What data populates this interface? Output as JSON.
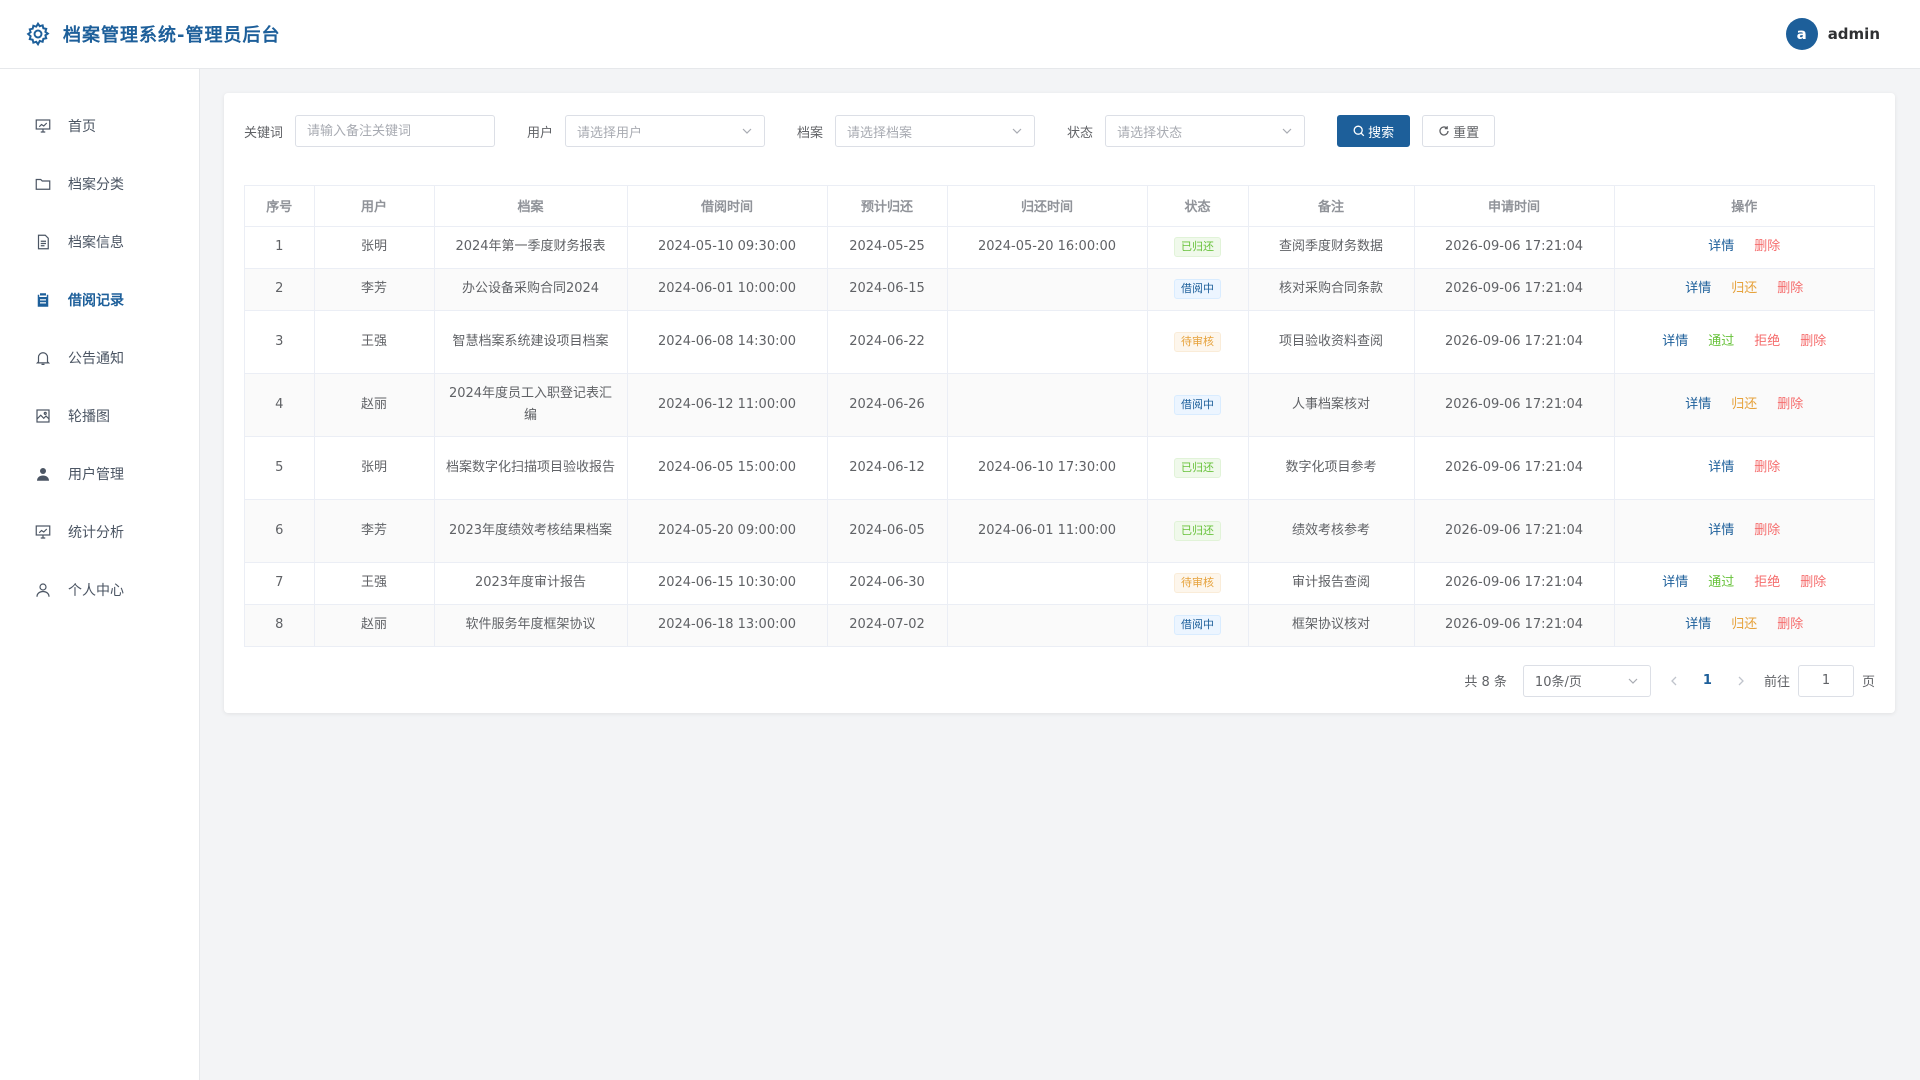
{
  "header": {
    "title": "档案管理系统-管理员后台",
    "avatar_letter": "a",
    "username": "admin"
  },
  "sidebar": {
    "items": [
      {
        "label": "首页",
        "icon": "monitor-icon"
      },
      {
        "label": "档案分类",
        "icon": "folder-icon"
      },
      {
        "label": "档案信息",
        "icon": "document-icon"
      },
      {
        "label": "借阅记录",
        "icon": "clipboard-icon",
        "active": true
      },
      {
        "label": "公告通知",
        "icon": "bell-icon"
      },
      {
        "label": "轮播图",
        "icon": "picture-icon"
      },
      {
        "label": "用户管理",
        "icon": "user-filled-icon"
      },
      {
        "label": "统计分析",
        "icon": "monitor-icon"
      },
      {
        "label": "个人中心",
        "icon": "user-icon"
      }
    ]
  },
  "filters": {
    "keyword_label": "关键词",
    "keyword_placeholder": "请输入备注关键词",
    "user_label": "用户",
    "user_placeholder": "请选择用户",
    "archive_label": "档案",
    "archive_placeholder": "请选择档案",
    "status_label": "状态",
    "status_placeholder": "请选择状态",
    "search_label": "搜索",
    "reset_label": "重置"
  },
  "table": {
    "columns": [
      "序号",
      "用户",
      "档案",
      "借阅时间",
      "预计归还",
      "归还时间",
      "状态",
      "备注",
      "申请时间",
      "操作"
    ],
    "rows": [
      {
        "no": "1",
        "user": "张明",
        "archive": "2024年第一季度财务报表",
        "borrow": "2024-05-10 09:30:00",
        "due": "2024-05-25",
        "returned": "2024-05-20 16:00:00",
        "status": "已归还",
        "status_type": "returned",
        "note": "查阅季度财务数据",
        "apply": "2026-09-06 17:21:04",
        "ops": [
          {
            "label": "详情",
            "type": "detail"
          },
          {
            "label": "删除",
            "type": "delete"
          }
        ]
      },
      {
        "no": "2",
        "user": "李芳",
        "archive": "办公设备采购合同2024",
        "borrow": "2024-06-01 10:00:00",
        "due": "2024-06-15",
        "returned": "",
        "status": "借阅中",
        "status_type": "borrowing",
        "note": "核对采购合同条款",
        "apply": "2026-09-06 17:21:04",
        "ops": [
          {
            "label": "详情",
            "type": "detail"
          },
          {
            "label": "归还",
            "type": "return"
          },
          {
            "label": "删除",
            "type": "delete"
          }
        ]
      },
      {
        "no": "3",
        "user": "王强",
        "archive": "智慧档案系统建设项目档案",
        "borrow": "2024-06-08 14:30:00",
        "due": "2024-06-22",
        "returned": "",
        "status": "待审核",
        "status_type": "pending",
        "note": "项目验收资料查阅",
        "apply": "2026-09-06 17:21:04",
        "ops": [
          {
            "label": "详情",
            "type": "detail"
          },
          {
            "label": "通过",
            "type": "approve"
          },
          {
            "label": "拒绝",
            "type": "reject"
          },
          {
            "label": "删除",
            "type": "delete"
          }
        ]
      },
      {
        "no": "4",
        "user": "赵丽",
        "archive": "2024年度员工入职登记表汇编",
        "borrow": "2024-06-12 11:00:00",
        "due": "2024-06-26",
        "returned": "",
        "status": "借阅中",
        "status_type": "borrowing",
        "note": "人事档案核对",
        "apply": "2026-09-06 17:21:04",
        "ops": [
          {
            "label": "详情",
            "type": "detail"
          },
          {
            "label": "归还",
            "type": "return"
          },
          {
            "label": "删除",
            "type": "delete"
          }
        ]
      },
      {
        "no": "5",
        "user": "张明",
        "archive": "档案数字化扫描项目验收报告",
        "borrow": "2024-06-05 15:00:00",
        "due": "2024-06-12",
        "returned": "2024-06-10 17:30:00",
        "status": "已归还",
        "status_type": "returned",
        "note": "数字化项目参考",
        "apply": "2026-09-06 17:21:04",
        "ops": [
          {
            "label": "详情",
            "type": "detail"
          },
          {
            "label": "删除",
            "type": "delete"
          }
        ]
      },
      {
        "no": "6",
        "user": "李芳",
        "archive": "2023年度绩效考核结果档案",
        "borrow": "2024-05-20 09:00:00",
        "due": "2024-06-05",
        "returned": "2024-06-01 11:00:00",
        "status": "已归还",
        "status_type": "returned",
        "note": "绩效考核参考",
        "apply": "2026-09-06 17:21:04",
        "ops": [
          {
            "label": "详情",
            "type": "detail"
          },
          {
            "label": "删除",
            "type": "delete"
          }
        ]
      },
      {
        "no": "7",
        "user": "王强",
        "archive": "2023年度审计报告",
        "borrow": "2024-06-15 10:30:00",
        "due": "2024-06-30",
        "returned": "",
        "status": "待审核",
        "status_type": "pending",
        "note": "审计报告查阅",
        "apply": "2026-09-06 17:21:04",
        "ops": [
          {
            "label": "详情",
            "type": "detail"
          },
          {
            "label": "通过",
            "type": "approve"
          },
          {
            "label": "拒绝",
            "type": "reject"
          },
          {
            "label": "删除",
            "type": "delete"
          }
        ]
      },
      {
        "no": "8",
        "user": "赵丽",
        "archive": "软件服务年度框架协议",
        "borrow": "2024-06-18 13:00:00",
        "due": "2024-07-02",
        "returned": "",
        "status": "借阅中",
        "status_type": "borrowing",
        "note": "框架协议核对",
        "apply": "2026-09-06 17:21:04",
        "ops": [
          {
            "label": "详情",
            "type": "detail"
          },
          {
            "label": "归还",
            "type": "return"
          },
          {
            "label": "删除",
            "type": "delete"
          }
        ]
      }
    ]
  },
  "pagination": {
    "total": "共 8 条",
    "page_size": "10条/页",
    "current_page": "1",
    "goto_label": "前往",
    "goto_value": "1",
    "page_unit": "页"
  },
  "colors": {
    "primary": "#1d5f9a",
    "success": "#67c23a",
    "warning": "#e6a23c",
    "danger": "#f56c6c"
  }
}
